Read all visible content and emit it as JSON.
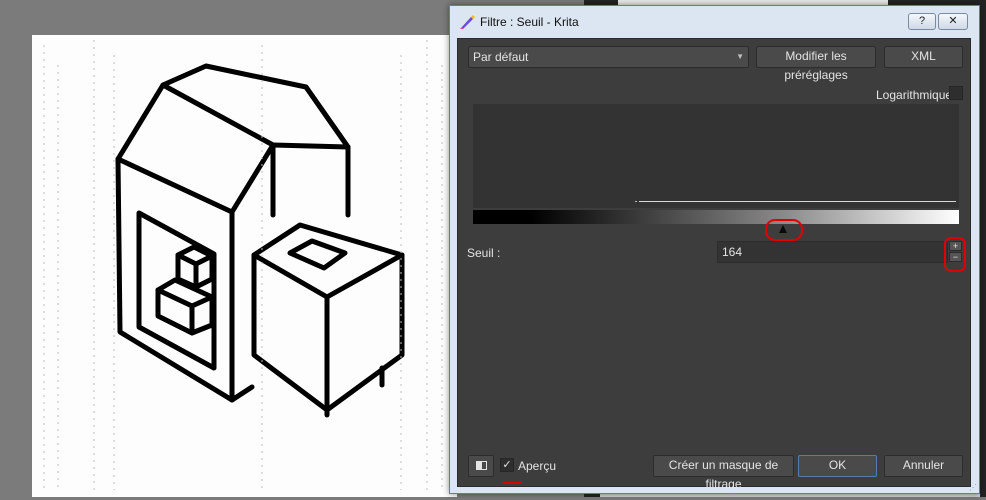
{
  "window": {
    "title": "Filtre : Seuil - Krita",
    "help_button": "?",
    "close_button": "✕"
  },
  "presets": {
    "selected": "Par défaut",
    "modify_button": "Modifier les préréglages",
    "xml_button": "XML"
  },
  "histogram": {
    "logarithmic_label": "Logarithmique",
    "logarithmic_checked": false
  },
  "threshold": {
    "label": "Seuil :",
    "value": "164",
    "spin_up": "+",
    "spin_down": "−"
  },
  "footer": {
    "preview_label": "Aperçu",
    "preview_checked": true,
    "preview_check_glyph": "✓",
    "create_mask_button": "Créer un masque de filtrage",
    "ok_button": "OK",
    "cancel_button": "Annuler"
  },
  "colors": {
    "dialog_background": "#3d3d3d",
    "annotation_red": "#e00000"
  }
}
